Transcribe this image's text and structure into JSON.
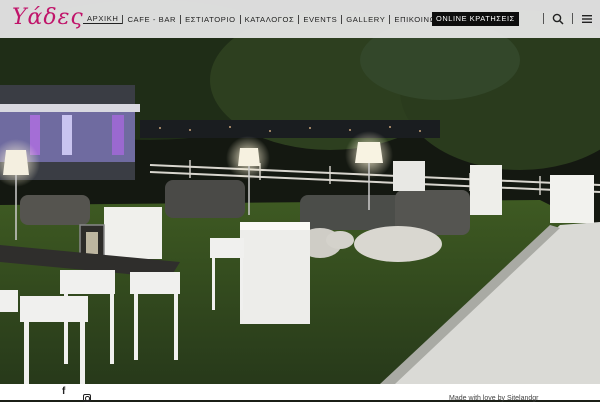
{
  "brand": {
    "logo_text": "Υάδες",
    "logo_color": "#c0146a"
  },
  "nav": {
    "items": [
      {
        "label": "ΑΡΧΙΚΗ",
        "active": true
      },
      {
        "label": "CAFE - BAR"
      },
      {
        "label": "ΕΣΤΙΑΤΟΡΙΟ"
      },
      {
        "label": "ΚΑΤΑΛΟΓΟΣ"
      },
      {
        "label": "EVENTS"
      },
      {
        "label": "GALLERY"
      },
      {
        "label": "ΕΠΙΚΟΙΝΩΝΙΑ"
      }
    ],
    "booking_label": "ONLINE ΚΡΑΤΗΣΕΙΣ",
    "icons": [
      "search-icon",
      "hamburger-menu-icon"
    ]
  },
  "hero": {
    "image": "night-garden-lounge-photo"
  },
  "footer": {
    "social_icons": [
      "facebook-icon",
      "instagram-icon"
    ],
    "facebook_glyph": "f",
    "credit": "Made with love by Sitelandgr"
  }
}
